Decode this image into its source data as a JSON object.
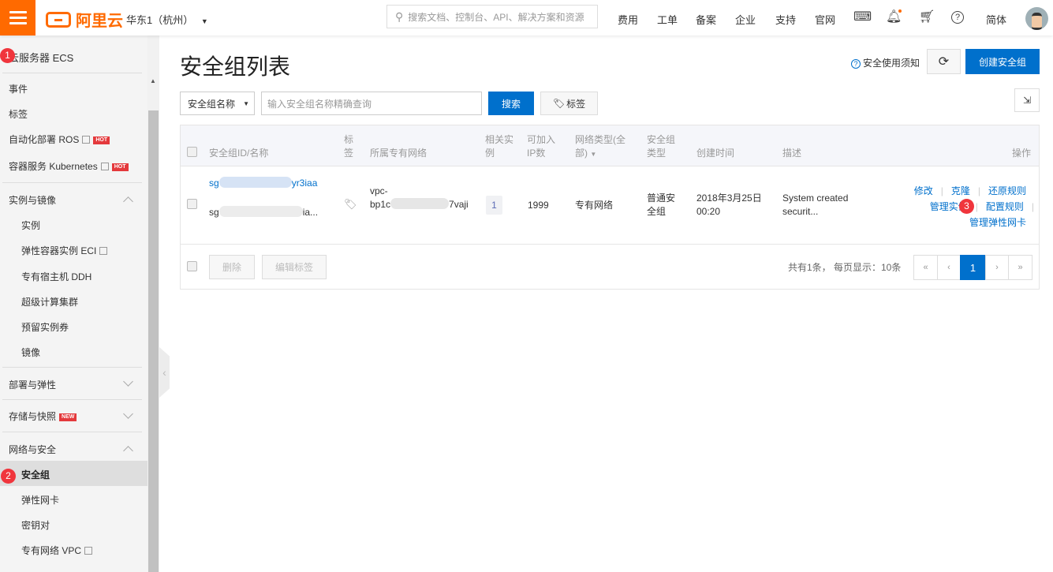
{
  "topbar": {
    "brand": "阿里云",
    "region": "华东1（杭州）",
    "search_placeholder": "搜索文档、控制台、API、解决方案和资源",
    "nav": [
      "费用",
      "工单",
      "备案",
      "企业",
      "支持",
      "官网"
    ],
    "language": "简体",
    "accent": "#ff6a00"
  },
  "sidebar": {
    "title": "云服务器 ECS",
    "top_items": [
      {
        "label": "事件"
      },
      {
        "label": "标签"
      },
      {
        "label": "自动化部署 ROS",
        "badge": "HOT"
      },
      {
        "label": "容器服务 Kubernetes",
        "badge": "HOT"
      }
    ],
    "groups": [
      {
        "label": "实例与镜像",
        "items": [
          "实例",
          "弹性容器实例 ECI",
          "专有宿主机 DDH",
          "超级计算集群",
          "预留实例券",
          "镜像"
        ]
      },
      {
        "label": "部署与弹性"
      },
      {
        "label": "存储与快照",
        "badge": "NEW"
      },
      {
        "label": "网络与安全",
        "items": [
          "安全组",
          "弹性网卡",
          "密钥对",
          "专有网络 VPC"
        ]
      }
    ]
  },
  "annotations": [
    "1",
    "2",
    "3"
  ],
  "page": {
    "title": "安全组列表",
    "help_link": "安全使用须知",
    "create_button": "创建安全组",
    "filter_select": "安全组名称",
    "search_placeholder": "输入安全组名称精确查询",
    "search_button": "搜索",
    "tag_button": "标签"
  },
  "table": {
    "headers": {
      "id_name": "安全组ID/名称",
      "tag": "标签",
      "vpc": "所属专有网络",
      "instances": "相关实例",
      "ip_count": "可加入IP数",
      "network_type": "网络类型(全部)",
      "sg_type": "安全组类型",
      "created": "创建时间",
      "description": "描述",
      "actions": "操作"
    },
    "rows": [
      {
        "id_prefix": "sg",
        "id_suffix": "yr3iaa",
        "name_prefix": "sg",
        "name_suffix": "ia...",
        "vpc_prefix": "vpc-",
        "vpc_line2_prefix": "bp1c",
        "vpc_suffix": "7vaji",
        "instances": "1",
        "ip_count": "1999",
        "network_type": "专有网络",
        "sg_type": "普通安全组",
        "created_date": "2018年3月25日",
        "created_time": "00:20",
        "description_line1": "System created",
        "description_line2": "securit...",
        "actions": [
          "修改",
          "克隆",
          "还原规则",
          "管理实例",
          "配置规则",
          "管理弹性网卡"
        ]
      }
    ],
    "footer": {
      "delete_button": "删除",
      "edit_tags_button": "编辑标签",
      "summary": "共有1条， 每页显示：10条",
      "pagination": {
        "first": "«",
        "prev": "‹",
        "current": "1",
        "next": "›",
        "last": "»"
      }
    }
  }
}
